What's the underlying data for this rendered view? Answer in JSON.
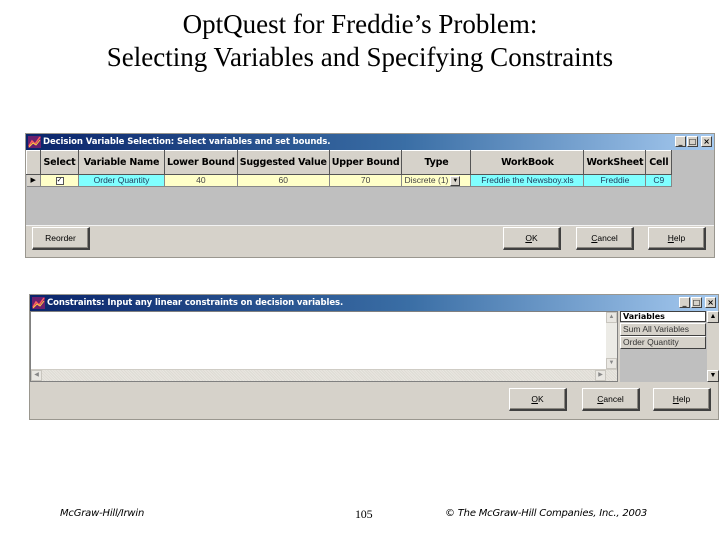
{
  "slide": {
    "title_line1": "OptQuest for Freddie’s Problem:",
    "title_line2": "Selecting Variables and Specifying Constraints"
  },
  "decision_dialog": {
    "title": "Decision Variable Selection: Select variables and set bounds.",
    "window_buttons": {
      "minimize": "_",
      "maximize": "□",
      "close": "×"
    },
    "columns": [
      "Select",
      "Variable Name",
      "Lower Bound",
      "Suggested Value",
      "Upper Bound",
      "Type",
      "WorkBook",
      "WorkSheet",
      "Cell"
    ],
    "rows": [
      {
        "row_indicator": "▶",
        "selected": true,
        "check_glyph": "✓",
        "variable_name": "Order Quantity",
        "lower_bound": "40",
        "suggested_value": "60",
        "upper_bound": "70",
        "type": "Discrete (1)",
        "type_dropdown_glyph": "▼",
        "workbook": "Freddie the Newsboy.xls",
        "worksheet": "Freddie",
        "cell": "C9"
      }
    ],
    "buttons": {
      "reorder": "Reorder",
      "ok_underline": "O",
      "ok_rest": "K",
      "cancel_underline": "C",
      "cancel_rest": "ancel",
      "help_underline": "H",
      "help_rest": "elp"
    }
  },
  "constraints_dialog": {
    "title": "Constraints: Input any linear constraints on decision variables.",
    "window_buttons": {
      "minimize": "_",
      "maximize": "□",
      "close": "×"
    },
    "constraint_text": "",
    "scroll_glyphs": {
      "up": "▲",
      "down": "▼",
      "left": "◀",
      "right": "▶"
    },
    "variables_header": "Variables",
    "variables": [
      "Sum All Variables",
      "Order Quantity"
    ],
    "buttons": {
      "ok_underline": "O",
      "ok_rest": "K",
      "cancel_underline": "C",
      "cancel_rest": "ancel",
      "help_underline": "H",
      "help_rest": "elp"
    }
  },
  "footer": {
    "publisher": "McGraw-Hill/Irwin",
    "page_number": "105",
    "copyright": "© The McGraw-Hill Companies, Inc., 2003"
  },
  "colors": {
    "titlebar_start": "#0a246a",
    "titlebar_end": "#a6caf0",
    "input_cell_yellow": "#ffffc8",
    "reference_cell_cyan": "#80ffff",
    "dialog_face": "#d6d2ca"
  }
}
